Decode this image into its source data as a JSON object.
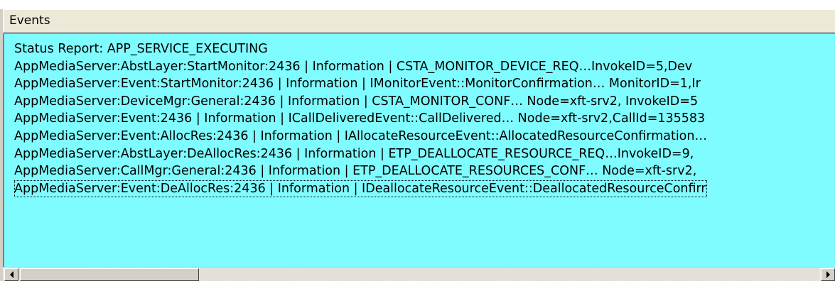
{
  "panel": {
    "title": "Events"
  },
  "events": [
    "Status Report: APP_SERVICE_EXECUTING",
    "AppMediaServer:AbstLayer:StartMonitor:2436 | Information | CSTA_MONITOR_DEVICE_REQ…InvokeID=5,Dev",
    "AppMediaServer:Event:StartMonitor:2436 | Information | IMonitorEvent::MonitorConfirmation… MonitorID=1,Ir",
    "AppMediaServer:DeviceMgr:General:2436 | Information | CSTA_MONITOR_CONF… Node=xft-srv2, InvokeID=5",
    "AppMediaServer:Event:2436 | Information | ICallDeliveredEvent::CallDelivered… Node=xft-srv2,CallId=135583",
    "AppMediaServer:Event:AllocRes:2436 | Information | IAllocateResourceEvent::AllocatedResourceConfirmation…",
    "AppMediaServer:AbstLayer:DeAllocRes:2436 | Information | ETP_DEALLOCATE_RESOURCE_REQ…InvokeID=9,",
    "AppMediaServer:CallMgr:General:2436 | Information | ETP_DEALLOCATE_RESOURCES_CONF… Node=xft-srv2,",
    "AppMediaServer:Event:DeAllocRes:2436 | Information | IDeallocateResourceEvent::DeallocatedResourceConfirr"
  ],
  "selected_index": 8,
  "colors": {
    "list_background": "#7ffcff",
    "header_background": "#ece9d8"
  },
  "scrollbar": {
    "left_icon": "arrow-left-icon",
    "right_icon": "arrow-right-icon"
  }
}
